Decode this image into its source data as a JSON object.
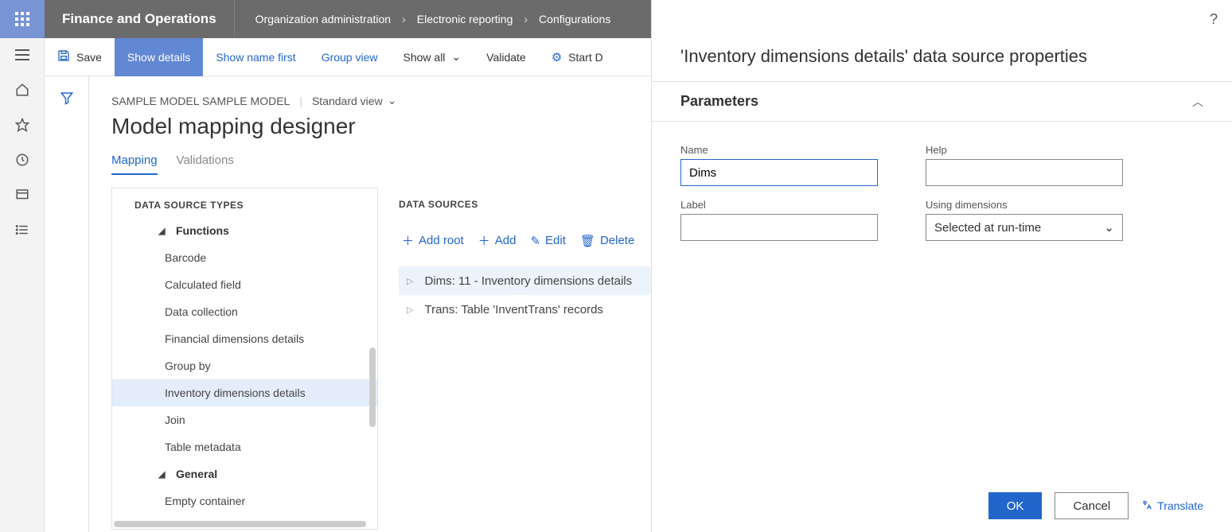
{
  "header": {
    "app_title": "Finance and Operations",
    "breadcrumb": [
      "Organization administration",
      "Electronic reporting",
      "Configurations"
    ]
  },
  "actionbar": {
    "save": "Save",
    "show_details": "Show details",
    "show_name_first": "Show name first",
    "group_view": "Group view",
    "show_all": "Show all",
    "validate": "Validate",
    "start_debug": "Start D"
  },
  "main": {
    "crumb": "SAMPLE MODEL SAMPLE MODEL",
    "view": "Standard view",
    "title": "Model mapping designer",
    "tabs": {
      "mapping": "Mapping",
      "validations": "Validations"
    },
    "col1_head": "DATA SOURCE TYPES",
    "col2_head": "DATA SOURCES",
    "tree": {
      "functions": "Functions",
      "items": [
        "Barcode",
        "Calculated field",
        "Data collection",
        "Financial dimensions details",
        "Group by",
        "Inventory dimensions details",
        "Join",
        "Table metadata"
      ],
      "general": "General",
      "general_items": [
        "Empty container"
      ]
    },
    "ds_actions": {
      "add_root": "Add root",
      "add": "Add",
      "edit": "Edit",
      "delete": "Delete"
    },
    "ds_rows": [
      "Dims: 11 - Inventory dimensions details",
      "Trans: Table 'InventTrans' records"
    ]
  },
  "pane": {
    "title": "'Inventory dimensions details' data source properties",
    "section": "Parameters",
    "fields": {
      "name_label": "Name",
      "name_value": "Dims",
      "label_label": "Label",
      "label_value": "",
      "help_label": "Help",
      "help_value": "",
      "using_label": "Using dimensions",
      "using_value": "Selected at run-time"
    },
    "footer": {
      "ok": "OK",
      "cancel": "Cancel",
      "translate": "Translate"
    }
  }
}
